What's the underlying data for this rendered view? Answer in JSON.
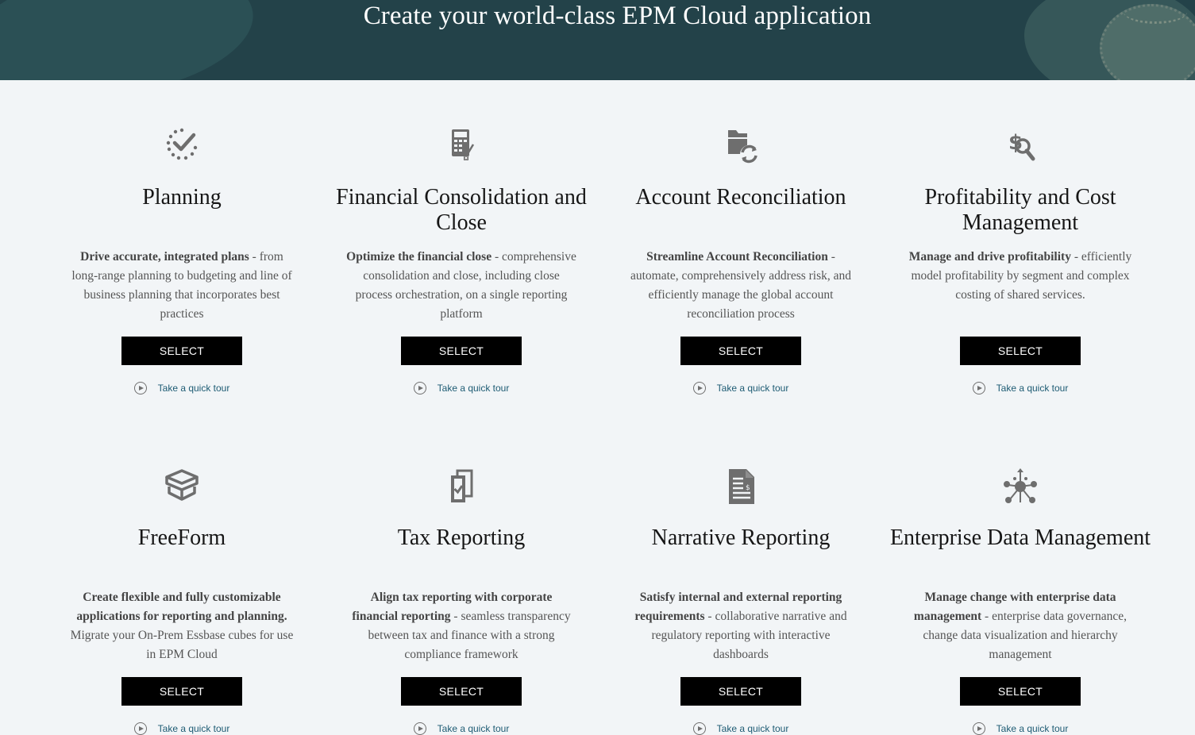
{
  "header": {
    "title": "Create your world-class EPM Cloud application"
  },
  "cards": [
    {
      "icon": "planning-check-icon",
      "title": "Planning",
      "desc_bold": "Drive accurate, integrated plans",
      "desc_rest": " - from long-range planning to budgeting and line of business planning that incorporates best practices",
      "button": "SELECT",
      "tour": "Take a quick tour"
    },
    {
      "icon": "calculator-icon",
      "title": "Financial Consolidation and Close",
      "desc_bold": "Optimize the financial close",
      "desc_rest": " - comprehensive consolidation and close, including close process orchestration, on a single reporting platform",
      "button": "SELECT",
      "tour": "Take a quick tour"
    },
    {
      "icon": "folder-sync-icon",
      "title": "Account Reconciliation",
      "desc_bold": "Streamline Account Reconciliation",
      "desc_rest": " - automate, comprehensively address risk, and efficiently manage the global account reconciliation process",
      "button": "SELECT",
      "tour": "Take a quick tour"
    },
    {
      "icon": "dollar-search-icon",
      "title": "Profitability and Cost Management",
      "desc_bold": "Manage and drive profitability",
      "desc_rest": " - efficiently model profitability by segment and complex costing of shared services.",
      "button": "SELECT",
      "tour": "Take a quick tour"
    },
    {
      "icon": "cube-boxes-icon",
      "title": "FreeForm",
      "desc_bold": "Create flexible and fully customizable applications for reporting and planning.",
      "desc_rest": " Migrate your On-Prem Essbase cubes for use in EPM Cloud",
      "button": "SELECT",
      "tour": "Take a quick tour"
    },
    {
      "icon": "tax-documents-icon",
      "title": "Tax Reporting",
      "desc_bold": "Align tax reporting with corporate financial reporting",
      "desc_rest": " - seamless transparency between tax and finance with a strong compliance framework",
      "button": "SELECT",
      "tour": "Take a quick tour"
    },
    {
      "icon": "report-document-icon",
      "title": "Narrative Reporting",
      "desc_bold": "Satisfy internal and external reporting requirements",
      "desc_rest": " - collaborative narrative and regulatory reporting with interactive dashboards",
      "button": "SELECT",
      "tour": "Take a quick tour"
    },
    {
      "icon": "hierarchy-network-icon",
      "title": "Enterprise Data Management",
      "desc_bold": "Manage change with enterprise data management",
      "desc_rest": " - enterprise data governance, change data visualization and hierarchy management",
      "button": "SELECT",
      "tour": "Take a quick tour"
    }
  ]
}
